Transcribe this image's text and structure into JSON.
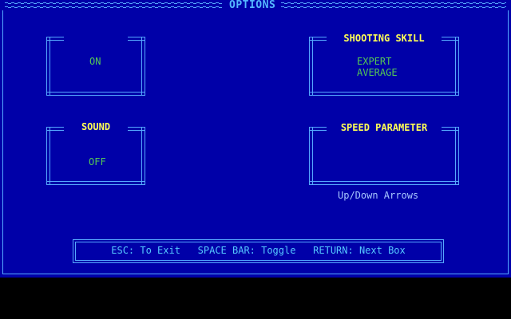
{
  "header": {
    "title": "OPTIONS"
  },
  "boxes": {
    "music": {
      "title": "",
      "options": [
        "ON"
      ]
    },
    "sound": {
      "title": "SOUND",
      "options": [
        "OFF"
      ]
    },
    "shooting_skill": {
      "title": "SHOOTING SKILL",
      "options": [
        "EXPERT",
        "AVERAGE"
      ]
    },
    "speed_parameter": {
      "title": "SPEED PARAMETER",
      "options": [],
      "hint": "Up/Down Arrows"
    }
  },
  "footer": {
    "esc": "ESC: To Exit",
    "space": "SPACE BAR: Toggle",
    "return": "RETURN: Next Box"
  },
  "colors": {
    "background": "#0000a8",
    "frame": "#55a8ff",
    "title": "#ffff55",
    "option": "#55c855"
  }
}
